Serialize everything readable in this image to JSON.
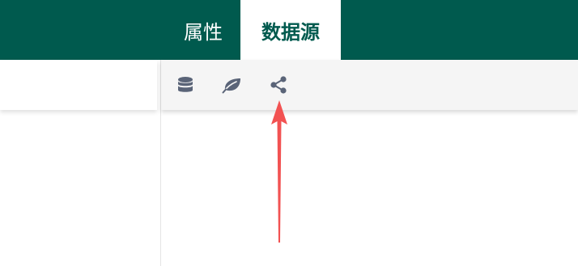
{
  "tabs": [
    {
      "label": "属性",
      "active": false
    },
    {
      "label": "数据源",
      "active": true
    }
  ],
  "colors": {
    "header_bg": "#005a4e",
    "active_tab_text": "#005a4e",
    "icon": "#5a6478",
    "annotation_arrow": "#f25252",
    "toolbar_bg": "#f5f5f5"
  },
  "toolbar": {
    "icons": [
      "database-icon",
      "leaf-icon",
      "share-icon"
    ]
  }
}
